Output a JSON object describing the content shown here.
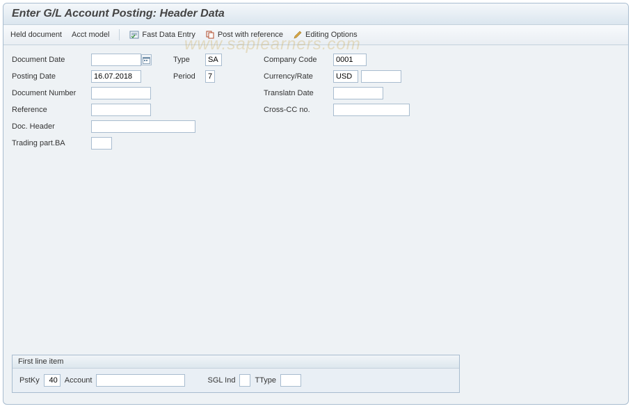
{
  "title": "Enter G/L Account Posting: Header Data",
  "toolbar": {
    "held_document": "Held document",
    "acct_model": "Acct model",
    "fast_data_entry": "Fast Data Entry",
    "post_with_reference": "Post with reference",
    "editing_options": "Editing Options"
  },
  "form": {
    "col1": {
      "document_date": {
        "label": "Document Date",
        "value": ""
      },
      "posting_date": {
        "label": "Posting Date",
        "value": "16.07.2018"
      },
      "document_number": {
        "label": "Document Number",
        "value": ""
      },
      "reference": {
        "label": "Reference",
        "value": ""
      },
      "doc_header": {
        "label": "Doc. Header",
        "value": ""
      },
      "trading_part_ba": {
        "label": "Trading part.BA",
        "value": ""
      }
    },
    "col2": {
      "type": {
        "label": "Type",
        "value": "SA"
      },
      "period": {
        "label": "Period",
        "value": "7"
      }
    },
    "col3": {
      "company_code": {
        "label": "Company Code",
        "value": "0001"
      },
      "currency_rate": {
        "label": "Currency/Rate",
        "value": "USD",
        "value2": ""
      },
      "translatn_date": {
        "label": "Translatn Date",
        "value": ""
      },
      "cross_cc_no": {
        "label": "Cross-CC no.",
        "value": ""
      }
    }
  },
  "first_line_item": {
    "group_title": "First line item",
    "pstky": {
      "label": "PstKy",
      "value": "40"
    },
    "account": {
      "label": "Account",
      "value": ""
    },
    "sgl_ind": {
      "label": "SGL Ind",
      "value": ""
    },
    "ttype": {
      "label": "TType",
      "value": ""
    }
  },
  "watermark": "www.saplearners.com"
}
